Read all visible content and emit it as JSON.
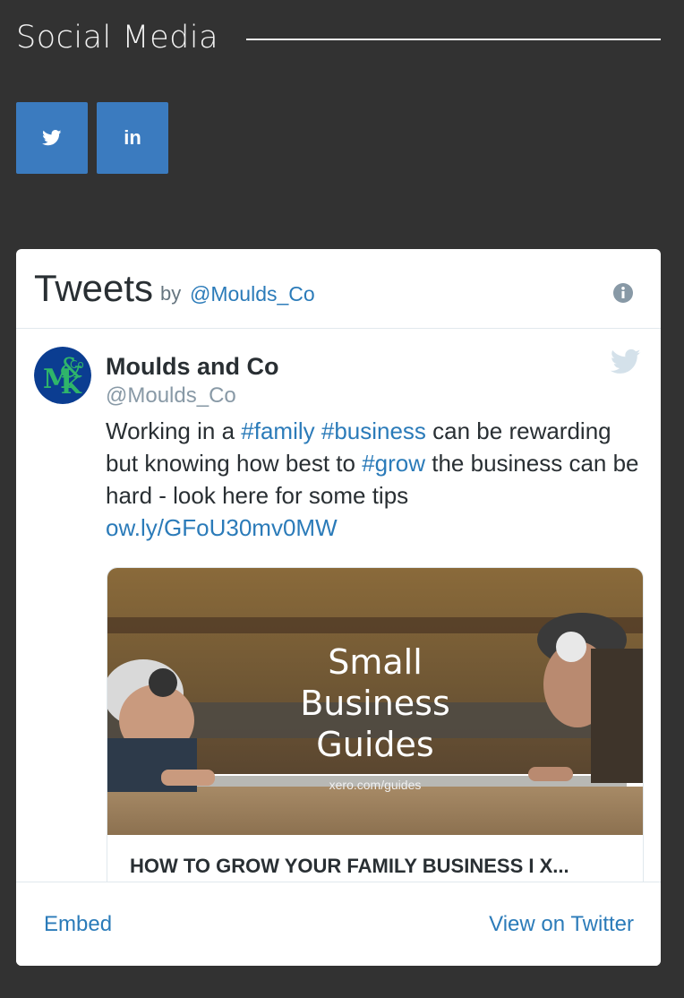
{
  "section": {
    "title": "Social Media"
  },
  "social": {
    "twitter_icon": "twitter-bird-icon",
    "linkedin_label": "in"
  },
  "widget": {
    "header": {
      "title": "Tweets",
      "by": "by",
      "handle": "@Moulds_Co",
      "info_icon": "info-icon"
    },
    "tweet": {
      "author_name": "Moulds and Co",
      "author_handle": "@Moulds_Co",
      "text_parts": {
        "p1": "Working in a ",
        "tag1": "#family",
        "p2": " ",
        "tag2": "#business",
        "p3": " can be rewarding but knowing how best to ",
        "tag3": "#grow",
        "p4": " the business can be hard - look here for some tips ",
        "link": "ow.ly/GFoU30mv0MW"
      },
      "card": {
        "overlay_line1": "Small",
        "overlay_line2": "Business",
        "overlay_line3": "Guides",
        "overlay_url": "xero.com/guides",
        "title": "HOW TO GROW YOUR FAMILY BUSINESS I X..."
      }
    },
    "footer": {
      "embed": "Embed",
      "view": "View on Twitter"
    }
  },
  "colors": {
    "background": "#323232",
    "button": "#3b7bbf",
    "link": "#2b7bb9"
  }
}
